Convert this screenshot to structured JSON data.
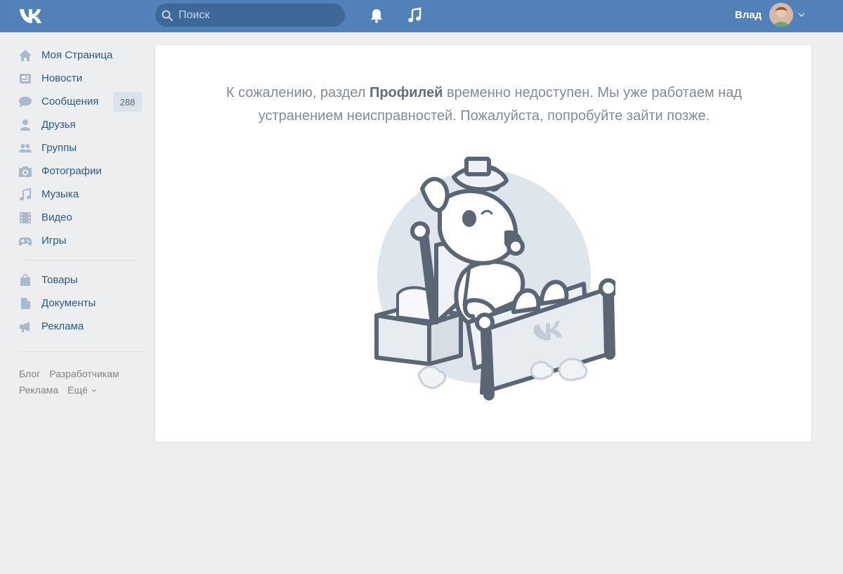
{
  "header": {
    "logo": "vk-logo",
    "search": {
      "placeholder": "Поиск",
      "icon": "search-icon"
    },
    "icons": [
      "bell-icon",
      "music-note-icon"
    ],
    "user": {
      "name": "Влад",
      "avatar": "avatar",
      "menu_icon": "chevron-down-icon"
    },
    "colors": {
      "bar": "#5181b8",
      "search_bg": "#3d6898"
    }
  },
  "sidebar": {
    "items": [
      {
        "label": "Моя Страница",
        "icon": "home-icon"
      },
      {
        "label": "Новости",
        "icon": "news-icon"
      },
      {
        "label": "Сообщения",
        "icon": "messages-icon",
        "count": "288"
      },
      {
        "label": "Друзья",
        "icon": "friend-icon"
      },
      {
        "label": "Группы",
        "icon": "groups-icon"
      },
      {
        "label": "Фотографии",
        "icon": "camera-icon"
      },
      {
        "label": "Музыка",
        "icon": "music-icon"
      },
      {
        "label": "Видео",
        "icon": "film-icon"
      },
      {
        "label": "Игры",
        "icon": "gamepad-icon"
      }
    ],
    "items2": [
      {
        "label": "Товары",
        "icon": "shopping-bag-icon"
      },
      {
        "label": "Документы",
        "icon": "document-icon"
      },
      {
        "label": "Реклама",
        "icon": "megaphone-icon"
      }
    ],
    "footer": [
      "Блог",
      "Разработчикам",
      "Реклама",
      "Ещё"
    ]
  },
  "main": {
    "message_before": "К сожалению, раздел ",
    "message_bold": "Профилей",
    "message_after": " временно недоступен. Мы уже работаем над устранением неисправностей. Пожалуйста, попробуйте зайти позже.",
    "illustration": "sick-dog-in-bed-illustration"
  }
}
